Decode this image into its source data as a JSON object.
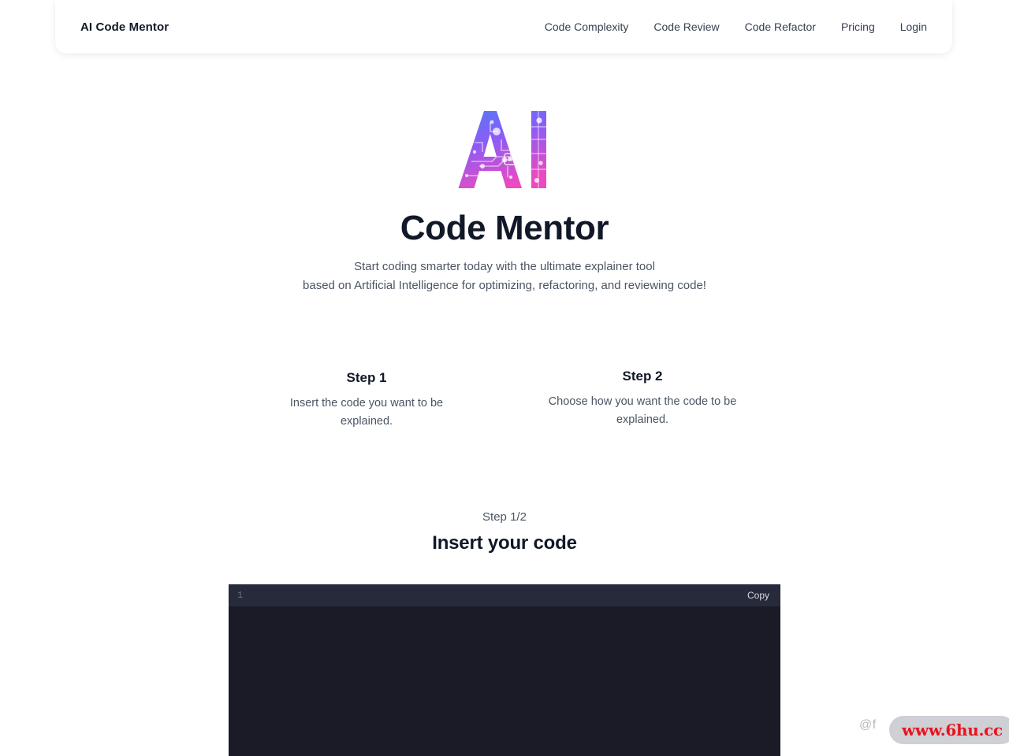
{
  "header": {
    "brand": "AI Code Mentor",
    "nav": [
      {
        "label": "Code Complexity"
      },
      {
        "label": "Code Review"
      },
      {
        "label": "Code Refactor"
      },
      {
        "label": "Pricing"
      },
      {
        "label": "Login"
      }
    ]
  },
  "hero": {
    "logo_alt": "AI",
    "logo_colors": {
      "gradient_start": "#4f7df3",
      "gradient_mid": "#8b5cf6",
      "gradient_end": "#ec4ac0"
    },
    "title": "Code Mentor",
    "subtitle_line1": "Start coding smarter today with the ultimate explainer tool",
    "subtitle_line2": "based on Artificial Intelligence for optimizing, refactoring, and reviewing code!"
  },
  "steps": [
    {
      "title": "Step 1",
      "description": "Insert the code you want to be explained."
    },
    {
      "title": "Step 2",
      "description": "Choose how you want the code to be explained."
    }
  ],
  "wizard": {
    "counter": "Step 1/2",
    "heading": "Insert your code"
  },
  "editor": {
    "line_number": "1",
    "copy_label": "Copy",
    "value": "",
    "placeholder": "",
    "background": "#1b1b27",
    "topbar_background": "#272a3b"
  },
  "watermark": {
    "handle": "@f",
    "badge_text": "www.6hu.cc",
    "badge_color": "#e8131c"
  }
}
